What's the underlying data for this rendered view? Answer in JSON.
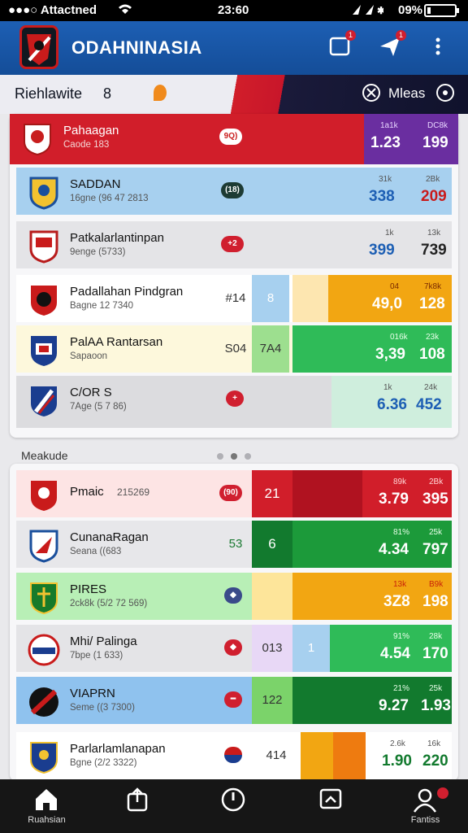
{
  "status": {
    "carrier": "●●●○ Attactned",
    "time": "23:60",
    "battery": "09%"
  },
  "app": {
    "title": "ODAHNINASIA"
  },
  "banner": {
    "left_label": "Riehlawite",
    "count": "8",
    "right_label": "Mleas"
  },
  "section2": {
    "title": "Meakude"
  },
  "top_rows": [
    {
      "name": "Pahaagan",
      "sub": "Caode 183",
      "pill": "9Q)",
      "s1_label": "1a1k",
      "s1_value": "1.23",
      "s2_label": "DC8k",
      "s2_value": "199"
    },
    {
      "name": "SADDAN",
      "sub": "16gne (96 47 2813",
      "pill": "(18)",
      "s1_label": "31k",
      "s1_value": "338",
      "s2_label": "2Bk",
      "s2_value": "209"
    },
    {
      "name": "Patkalarlantinpan",
      "sub": "9enge (5733)",
      "pill": "+2",
      "s1_label": "1k",
      "s1_value": "399",
      "s2_label": "13k",
      "s2_value": "739"
    },
    {
      "name": "Padallahan Pindgran",
      "sub": "Bagne 12 7340",
      "mid1": "#14",
      "mid2": "8",
      "s1_label": "04",
      "s1_value": "49,0",
      "s2_label": "7k8k",
      "s2_value": "128"
    },
    {
      "name": "PalAA Rantarsan",
      "sub": "Sapaoon",
      "mid1": "S04",
      "mid2": "7A4",
      "s1_label": "016k",
      "s1_value": "3,39",
      "s2_label": "23k",
      "s2_value": "108"
    },
    {
      "name": "C/OR S",
      "sub": "7Age (5 7 86)",
      "pill": "+",
      "s1_label": "1k",
      "s1_value": "6.36",
      "s2_label": "24k",
      "s2_value": "452"
    }
  ],
  "bottom_rows": [
    {
      "name": "Pmaic",
      "sub": "215269",
      "pill": "(90)",
      "mid1": "21",
      "s1_label": "89k",
      "s1_value": "3.79",
      "s2_label": "2Bk",
      "s2_value": "395"
    },
    {
      "name": "CunanaRagan",
      "sub": "Seana ((683",
      "mid0": "53",
      "mid1": "6",
      "s1_label": "81%",
      "s1_value": "4.34",
      "s2_label": "25k",
      "s2_value": "797"
    },
    {
      "name": "PIRES",
      "sub": "2ck8k (5/2 72 569)",
      "s1_label": "13k",
      "s1_value": "3Z8",
      "s2_label": "B9k",
      "s2_value": "198"
    },
    {
      "name": "Mhi/ Palinga",
      "sub": "7bpe (1 633)",
      "mid0": "013",
      "mid1": "1",
      "s1_label": "91%",
      "s1_value": "4.54",
      "s2_label": "28k",
      "s2_value": "170"
    },
    {
      "name": "VIAPRN",
      "sub": "Seme ((3 7300)",
      "mid0": "122",
      "s1_label": "21%",
      "s1_value": "9.27",
      "s2_label": "25k",
      "s2_value": "1.93"
    },
    {
      "name": "Parlarlamlanapan",
      "sub": "Bgne (2/2 3322)",
      "mid0": "414",
      "s1_label": "2.6k",
      "s1_value": "1.90",
      "s2_label": "16k",
      "s2_value": "220"
    }
  ],
  "nav": [
    {
      "label": "Ruahsian"
    },
    {
      "label": ""
    },
    {
      "label": ""
    },
    {
      "label": ""
    },
    {
      "label": "Fantiss"
    }
  ],
  "colors": {
    "red": "#d11e2a",
    "blue": "#1d5fb4",
    "green": "#1c9a3a",
    "orange": "#f2a612",
    "purple": "#6a2ea0"
  }
}
